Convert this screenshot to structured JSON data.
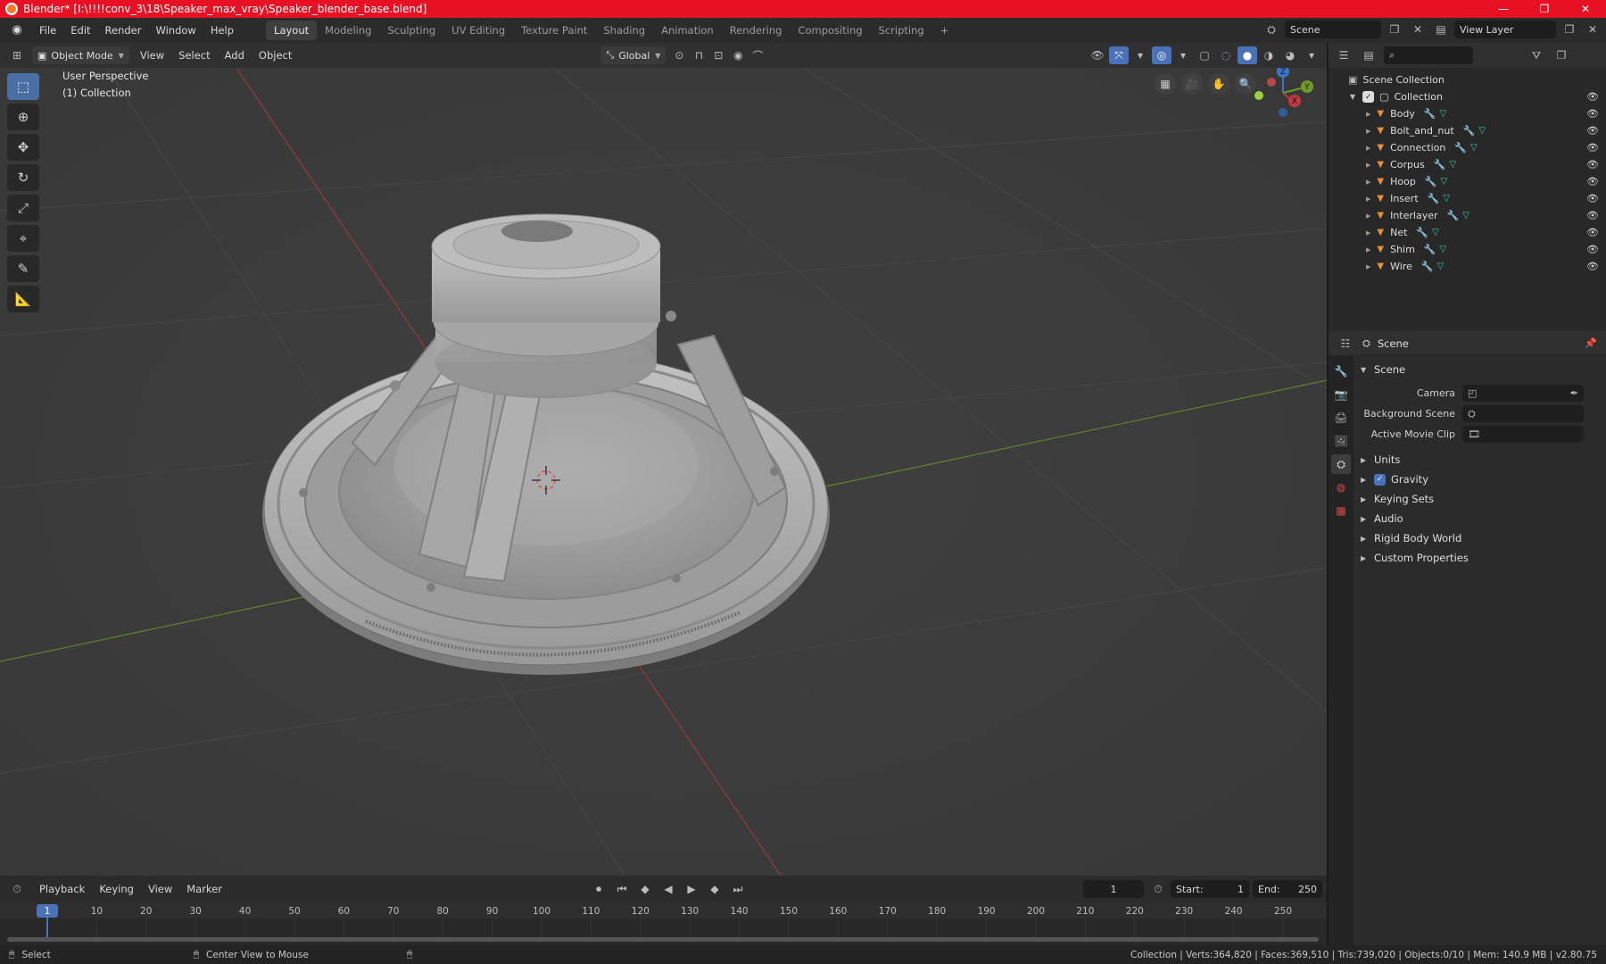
{
  "window": {
    "title": "Blender* [I:\\!!!!conv_3\\18\\Speaker_max_vray\\Speaker_blender_base.blend]",
    "controls": [
      "—",
      "❐",
      "✕"
    ]
  },
  "menu": [
    "File",
    "Edit",
    "Render",
    "Window",
    "Help"
  ],
  "workspaces": [
    "Layout",
    "Modeling",
    "Sculpting",
    "UV Editing",
    "Texture Paint",
    "Shading",
    "Animation",
    "Rendering",
    "Compositing",
    "Scripting"
  ],
  "active_workspace": "Layout",
  "topright": {
    "scene": "Scene",
    "view_layer": "View Layer"
  },
  "viewport_header": {
    "mode": "Object Mode",
    "menus": [
      "View",
      "Select",
      "Add",
      "Object"
    ],
    "orientation": "Global"
  },
  "viewport": {
    "perspective_label": "User Perspective",
    "collection_label": "(1) Collection",
    "gizmo": {
      "x": "X",
      "y": "Y",
      "z": "Z"
    }
  },
  "timeline": {
    "menus": [
      "Playback",
      "Keying",
      "View",
      "Marker"
    ],
    "current_frame": "1",
    "start_label": "Start:",
    "start": "1",
    "end_label": "End:",
    "end": "250",
    "ruler": [
      "1",
      "10",
      "20",
      "30",
      "40",
      "50",
      "60",
      "70",
      "80",
      "90",
      "100",
      "110",
      "120",
      "130",
      "140",
      "150",
      "160",
      "170",
      "180",
      "190",
      "200",
      "210",
      "220",
      "230",
      "240",
      "250"
    ]
  },
  "statusbar": {
    "left_action": "Select",
    "middle_action": "Center View to Mouse",
    "stats": "Collection | Verts:364,820 | Faces:369,510 | Tris:739,020 | Objects:0/10 | Mem: 140.9 MB | v2.80.75"
  },
  "outliner": {
    "root": "Scene Collection",
    "collection": "Collection",
    "objects": [
      "Body",
      "Bolt_and_nut",
      "Connection",
      "Corpus",
      "Hoop",
      "Insert",
      "Interlayer",
      "Net",
      "Shim",
      "Wire"
    ]
  },
  "properties": {
    "header": "Scene",
    "panel": "Scene",
    "fields": [
      {
        "label": "Camera"
      },
      {
        "label": "Background Scene"
      },
      {
        "label": "Active Movie Clip"
      }
    ],
    "subpanels": [
      "Units",
      "Gravity",
      "Keying Sets",
      "Audio",
      "Rigid Body World",
      "Custom Properties"
    ]
  },
  "colors": {
    "title_bar": "#e81123",
    "accent": "#4a72b8",
    "x_axis": "#c3383f",
    "y_axis": "#6c9b2a",
    "z_axis": "#3a77c8",
    "object_icon": "#e8913a",
    "mesh_icon": "#39c6a7",
    "modifier_icon": "#5b8fd6"
  }
}
